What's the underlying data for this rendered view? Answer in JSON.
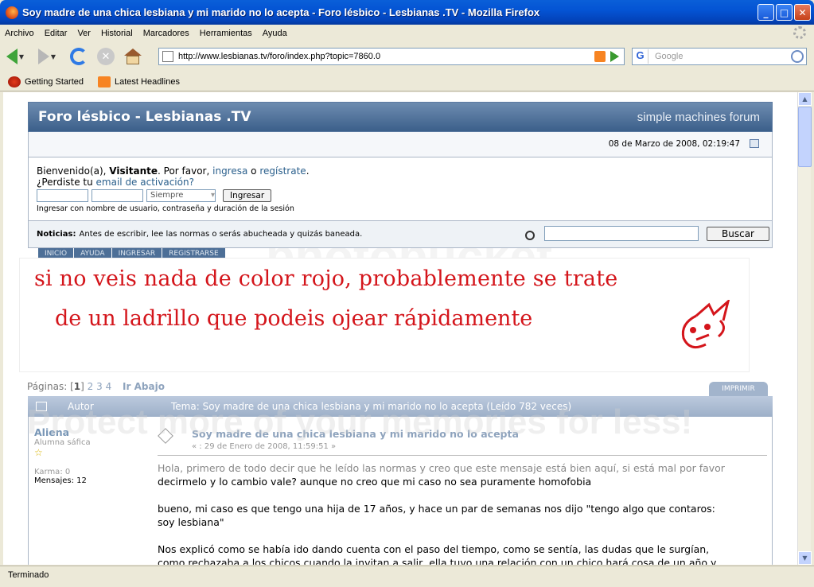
{
  "window": {
    "title": "Soy madre de una chica lesbiana y mi marido no lo acepta - Foro lésbico - Lesbianas .TV - Mozilla Firefox",
    "minimize": "_",
    "maximize": "□",
    "close": "✕"
  },
  "menu": [
    "Archivo",
    "Editar",
    "Ver",
    "Historial",
    "Marcadores",
    "Herramientas",
    "Ayuda"
  ],
  "nav": {
    "url": "http://www.lesbianas.tv/foro/index.php?topic=7860.0",
    "search_placeholder": "Google",
    "search_engine": "G"
  },
  "bookmarks": [
    "Getting Started",
    "Latest Headlines"
  ],
  "status": "Terminado",
  "forum": {
    "title": "Foro lésbico - Lesbianas .TV",
    "brand": "simple machines forum",
    "date": "08 de Marzo de 2008, 02:19:47",
    "welcome_prefix": "Bienvenido(a),",
    "visitor": "Visitante",
    "welcome_mid": ". Por favor,",
    "login_link": "ingresa",
    "or": "o",
    "register_link": "regístrate",
    "lost_prefix": "¿Perdiste tu",
    "activation_link": "email de activación?",
    "duration_option": "Siempre",
    "login_button": "Ingresar",
    "login_hint": "Ingresar con nombre de usuario, contraseña y duración de la sesión",
    "news_label": "Noticias:",
    "news_text": "Antes de escribir, lee las normas o serás abucheada y quizás baneada.",
    "search_button": "Buscar",
    "tabs": [
      "INICIO",
      "AYUDA",
      "INGRESAR",
      "REGISTRARSE"
    ]
  },
  "banner": {
    "line1": "si no veis nada de color rojo, probablemente se trate",
    "line2": "de un ladrillo que podeis ojear rápidamente"
  },
  "topic": {
    "pages_label": "Páginas: [",
    "current_page": "1",
    "pages_close": "]",
    "other_pages": [
      "2",
      "3",
      "4"
    ],
    "go_down": "Ir Abajo",
    "print": "IMPRIMIR",
    "author_col": "Autor",
    "header": "Tema: Soy madre de una chica lesbiana y mi marido no lo acepta  (Leído 782 veces)"
  },
  "post": {
    "author": "Aliena",
    "rank": "Alumna sáfica",
    "star": "☆",
    "karma": "Karma: 0",
    "messages": "Mensajes: 12",
    "title": "Soy madre de una chica lesbiana y mi marido no lo acepta",
    "date": "« : 29 de Enero de 2008, 11:59:51 »",
    "p1a": "Hola, primero de todo decir que he leído las normas y creo que este mensaje está bien aquí, si está mal por favor",
    "p1b": "decirmelo y lo cambio vale? aunque no creo que mi caso no sea puramente homofobia",
    "p2a": "bueno, mi caso es que tengo una hija de 17 años, y hace un par de semanas nos dijo \"tengo algo que contaros:",
    "p2b": "soy lesbiana\"",
    "p3a": "Nos explicó como se había ido dando cuenta con el paso del tiempo, como se sentía, las dudas que le surgían,",
    "p3b": "como rechazaba a los chicos cuando la invitan a salir, ella tuvo una relación con un chico hará cosa de un año y"
  },
  "watermark": {
    "line1": "photobucket",
    "line2": "Protect more of your memories for less!"
  }
}
